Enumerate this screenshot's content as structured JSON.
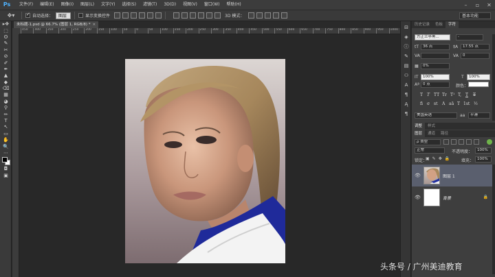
{
  "app": {
    "logo": "Ps",
    "menu": [
      "文件(F)",
      "编辑(E)",
      "图像(I)",
      "图层(L)",
      "文字(Y)",
      "选择(S)",
      "滤镜(T)",
      "3D(D)",
      "视图(V)",
      "窗口(W)",
      "帮助(H)"
    ],
    "window_controls": [
      "–",
      "▫",
      "✕"
    ]
  },
  "options": {
    "auto_select_label": "自动选择：",
    "auto_select_checked": true,
    "auto_select_target": "图层",
    "show_transform_label": "显示变换控件",
    "show_transform_checked": false,
    "mode_3d_label": "3D 模式：",
    "workspace": "基本功能"
  },
  "document": {
    "tab_title": "未标题-1.psd @ 66.7% (图层 1, RGB/8) *",
    "close_glyph": "×",
    "ruler_top_ticks": [
      "450",
      "400",
      "350",
      "300",
      "250",
      "200",
      "150",
      "100",
      "50",
      "0",
      "50",
      "100",
      "150",
      "200",
      "250",
      "300",
      "350",
      "400",
      "450",
      "500",
      "550",
      "600",
      "650",
      "700",
      "750",
      "800",
      "850",
      "900",
      "950",
      "1000"
    ]
  },
  "tools": [
    "▸✥",
    "⬚",
    "ʘ",
    "✎",
    "✂",
    "⊘",
    "✐",
    "✒",
    "▲",
    "◆",
    "⌫",
    "▦",
    "◕",
    "⚲",
    "✏",
    "T",
    "↖",
    "▭",
    "✋",
    "🔍",
    "⋯"
  ],
  "character_panel": {
    "tabs": [
      "历史记录",
      "色板",
      "字符"
    ],
    "active_tab": "字符",
    "font_family": "方正兰亭黑...",
    "font_style": "-",
    "font_size": "36 点",
    "leading": "17.55 点",
    "kerning": "",
    "tracking": "0",
    "tsume": "0%",
    "vertical_scale": "100%",
    "horizontal_scale": "100%",
    "baseline_shift": "0 点",
    "color_label": "颜色：",
    "color": "#ffffff",
    "style_buttons": [
      "T",
      "T",
      "TT",
      "Tr",
      "T¹",
      "T,",
      "T",
      "T"
    ],
    "opentype_buttons": [
      "fi",
      "σ",
      "st",
      "A",
      "aā",
      "T",
      "1st",
      "½"
    ],
    "language": "美国英语",
    "antialias_label": "aa",
    "antialias": "平滑"
  },
  "layers_panel": {
    "tabs": [
      "调整",
      "样式"
    ],
    "tabs2": [
      "图层",
      "通道",
      "路径"
    ],
    "active_tab": "图层",
    "filter_label": "ρ 类型",
    "blend_mode": "正常",
    "opacity_label": "不透明度：",
    "opacity": "100%",
    "lock_label": "锁定：",
    "fill_label": "填充：",
    "fill": "100%",
    "layers": [
      {
        "name": "图层 1",
        "visible": true,
        "selected": true,
        "type": "photo"
      },
      {
        "name": "背景",
        "visible": true,
        "selected": false,
        "type": "white",
        "locked": true
      }
    ]
  },
  "watermark": "头条号 / 广州美迪教育"
}
